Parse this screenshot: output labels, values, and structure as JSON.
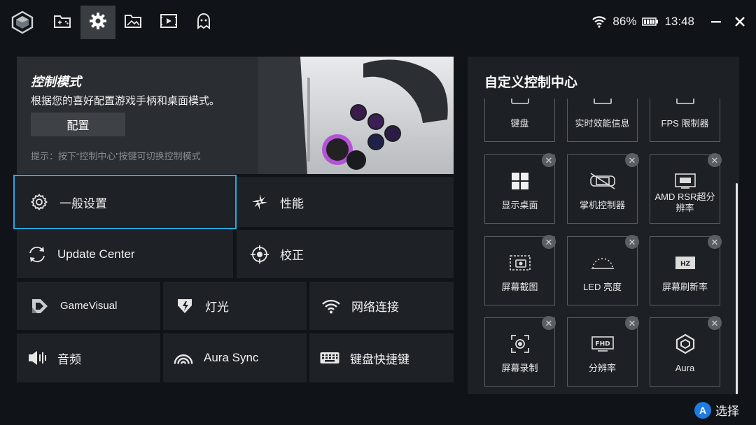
{
  "topbar": {
    "tabs": [
      {
        "icon": "gamepad-library-icon"
      },
      {
        "icon": "gear-icon",
        "active": true
      },
      {
        "icon": "gallery-folder-icon"
      },
      {
        "icon": "video-play-icon"
      },
      {
        "icon": "ghost-icon"
      }
    ],
    "battery": "86%",
    "time": "13:48"
  },
  "banner": {
    "title": "控制模式",
    "description": "根据您的喜好配置游戏手柄和桌面模式。",
    "button": "配置",
    "hint": "提示：按下“控制中心”按键可切换控制模式"
  },
  "tiles": {
    "general": "一般设置",
    "performance": "性能",
    "update": "Update Center",
    "calibration": "校正",
    "gamevisual": "GameVisual",
    "lighting": "灯光",
    "network": "网络连接",
    "audio": "音频",
    "aura_sync": "Aura Sync",
    "keyboard_shortcuts": "键盘快捷键"
  },
  "control_center": {
    "title": "自定义控制中心",
    "items": [
      {
        "label": "键盘",
        "icon": "keyboard-icon"
      },
      {
        "label": "实时效能信息",
        "icon": "monitor-icon"
      },
      {
        "label": "FPS 限制器",
        "icon": "fps-icon"
      },
      {
        "label": "显示桌面",
        "icon": "windows-icon"
      },
      {
        "label": "掌机控制器",
        "icon": "controller-off-icon"
      },
      {
        "label": "AMD RSR超分辨率",
        "icon": "hd-icon"
      },
      {
        "label": "屏幕截图",
        "icon": "screenshot-icon"
      },
      {
        "label": "LED 亮度",
        "icon": "led-brightness-icon"
      },
      {
        "label": "屏幕刷新率",
        "icon": "refresh-rate-icon"
      },
      {
        "label": "屏幕录制",
        "icon": "screen-record-icon"
      },
      {
        "label": "分辨率",
        "icon": "fhd-icon"
      },
      {
        "label": "Aura",
        "icon": "aura-icon"
      }
    ]
  },
  "footer": {
    "button_letter": "A",
    "action": "选择"
  },
  "colors": {
    "accent_selected": "#29a8e0",
    "a_button": "#1f7be0"
  }
}
